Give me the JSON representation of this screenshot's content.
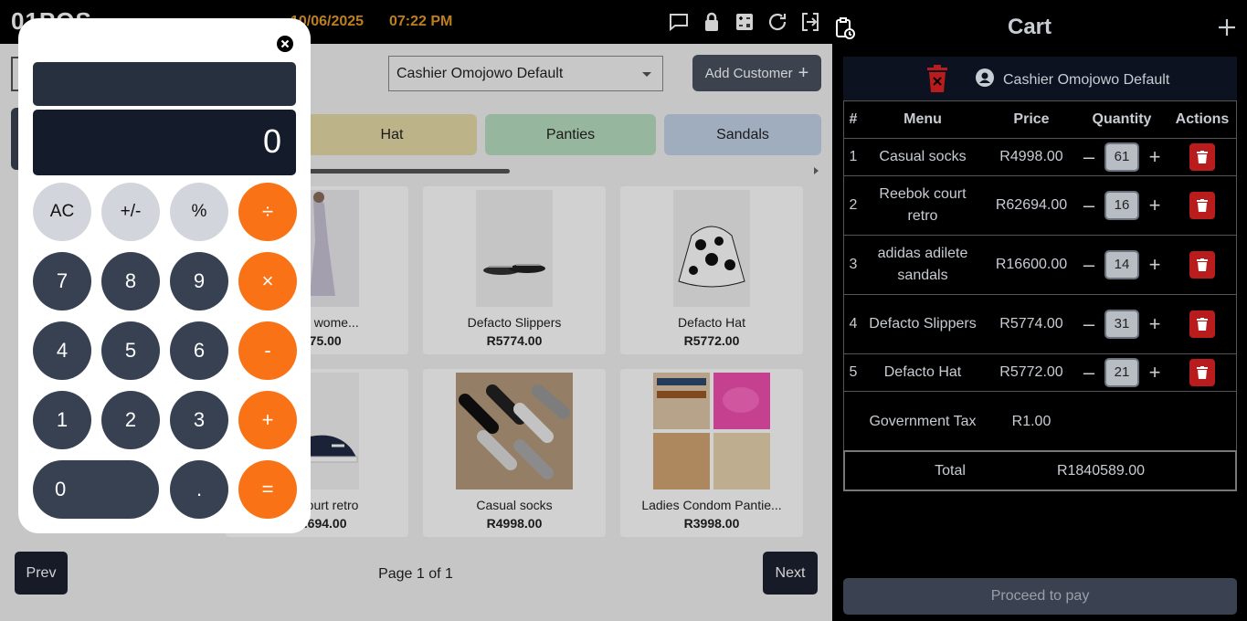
{
  "topbar": {
    "logo": "01POS",
    "date": "10/06/2025",
    "time": "07:22 PM",
    "icons": [
      "chat-icon",
      "lock-icon",
      "calculator-icon",
      "refresh-icon",
      "logout-icon"
    ]
  },
  "main": {
    "cashier_select": "Cashier Omojowo Default",
    "add_customer": "Add Customer",
    "categories": [
      {
        "label": "Hat",
        "color": "#e6dba6"
      },
      {
        "label": "Panties",
        "color": "#b8dec0"
      },
      {
        "label": "Sandals",
        "color": "#c3d3e8"
      }
    ],
    "products": [
      {
        "name": "...gular wome...",
        "price": "...75.00"
      },
      {
        "name": "Defacto Slippers",
        "price": "R5774.00"
      },
      {
        "name": "Defacto Hat",
        "price": "R5772.00"
      },
      {
        "name": "...court retro",
        "price": "...694.00"
      },
      {
        "name": "Casual socks",
        "price": "R4998.00"
      },
      {
        "name": "Ladies Condom Pantie...",
        "price": "R3998.00"
      }
    ],
    "prev": "Prev",
    "next": "Next",
    "page_info": "Page 1 of 1"
  },
  "calculator": {
    "history": "",
    "display": "0",
    "keys": {
      "ac": "AC",
      "sign": "+/-",
      "percent": "%",
      "divide": "÷",
      "k7": "7",
      "k8": "8",
      "k9": "9",
      "multiply": "×",
      "k4": "4",
      "k5": "5",
      "k6": "6",
      "minus": "-",
      "k1": "1",
      "k2": "2",
      "k3": "3",
      "plus": "+",
      "k0": "0",
      "dot": ".",
      "equals": "="
    }
  },
  "cart": {
    "title": "Cart",
    "cashier": "Cashier Omojowo Default",
    "headers": {
      "num": "#",
      "menu": "Menu",
      "price": "Price",
      "quantity": "Quantity",
      "actions": "Actions"
    },
    "items": [
      {
        "num": "1",
        "menu": "Casual socks",
        "price": "R4998.00",
        "qty": "61"
      },
      {
        "num": "2",
        "menu": "Reebok court retro",
        "price": "R62694.00",
        "qty": "16"
      },
      {
        "num": "3",
        "menu": "adidas adilete sandals",
        "price": "R16600.00",
        "qty": "14"
      },
      {
        "num": "4",
        "menu": "Defacto Slippers",
        "price": "R5774.00",
        "qty": "31"
      },
      {
        "num": "5",
        "menu": "Defacto Hat",
        "price": "R5772.00",
        "qty": "21"
      }
    ],
    "tax_label": "Government Tax",
    "tax_value": "R1.00",
    "total_label": "Total",
    "total_value": "R1840589.00",
    "pay": "Proceed to pay"
  }
}
